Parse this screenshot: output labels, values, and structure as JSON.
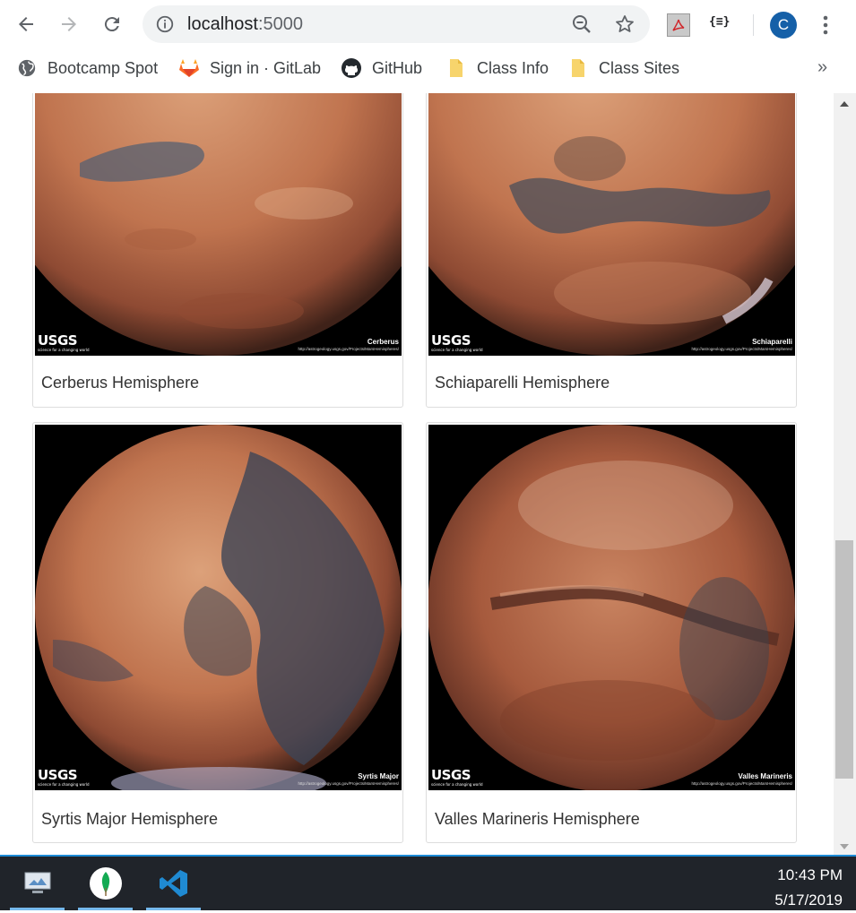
{
  "browser": {
    "url_host": "localhost",
    "url_port": ":5000",
    "profile_initial": "C",
    "json_ext_label": "{≡}"
  },
  "bookmarks": {
    "items": [
      {
        "label": "Bootcamp Spot",
        "icon": "globe-icon"
      },
      {
        "label": "Sign in · GitLab",
        "icon": "gitlab-icon"
      },
      {
        "label": "GitHub",
        "icon": "github-icon"
      },
      {
        "label": "Class Info",
        "icon": "folder-icon"
      },
      {
        "label": "Class Sites",
        "icon": "folder-icon"
      }
    ],
    "more": "»"
  },
  "hemispheres": [
    {
      "title": "Cerberus Hemisphere",
      "image_label": "Cerberus"
    },
    {
      "title": "Schiaparelli Hemisphere",
      "image_label": "Schiaparelli"
    },
    {
      "title": "Syrtis Major Hemisphere",
      "image_label": "Syrtis Major"
    },
    {
      "title": "Valles Marineris Hemisphere",
      "image_label": "Valles Marineris"
    }
  ],
  "image_overlay": {
    "logo": "USGS",
    "tagline": "science for a changing world",
    "url": "http://astrogeology.usgs.gov/Projects/MarsHemispheres/"
  },
  "scroll_position": 0.88,
  "taskbar": {
    "apps": [
      "remote-desktop-icon",
      "mongodb-icon",
      "vscode-icon"
    ],
    "time": "10:43 PM",
    "date": "5/17/2019"
  },
  "colors": {
    "mars_light": "#d99a72",
    "mars_mid": "#b8694a",
    "mars_dark": "#6a3a2c",
    "mars_shadow": "#3b4756",
    "accent_blue": "#1560a8"
  }
}
